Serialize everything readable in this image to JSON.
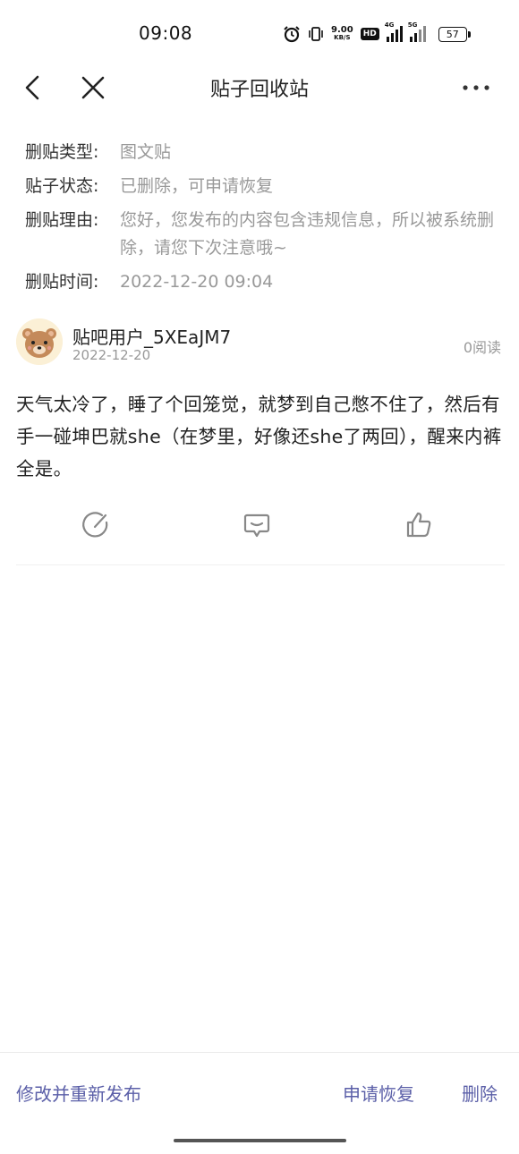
{
  "status_bar": {
    "time": "09:08",
    "net_speed_value": "9.00",
    "net_speed_unit": "KB/S",
    "hd_label": "HD",
    "signal1_tag": "4G",
    "signal2_tag": "5G",
    "battery": "57"
  },
  "nav": {
    "title": "贴子回收站"
  },
  "info": {
    "rows": [
      {
        "label": "删贴类型:",
        "value": "图文贴"
      },
      {
        "label": "贴子状态:",
        "value": "已删除，可申请恢复"
      },
      {
        "label": "删贴理由:",
        "value": "您好，您发布的内容包含违规信息，所以被系统删除，请您下次注意哦~"
      },
      {
        "label": "删贴时间:",
        "value": "2022-12-20 09:04"
      }
    ]
  },
  "post": {
    "user_name": "贴吧用户_5XEaJM7",
    "date": "2022-12-20",
    "read_count": "0阅读",
    "content": "天气太冷了，睡了个回笼觉，就梦到自己憋不住了，然后有手一碰坤巴就she（在梦里，好像还she了两回），醒来内裤全是。"
  },
  "bottom": {
    "edit_label": "修改并重新发布",
    "restore_label": "申请恢复",
    "delete_label": "删除"
  },
  "colors": {
    "accent": "#5b5fa8",
    "muted_text": "#999999"
  }
}
